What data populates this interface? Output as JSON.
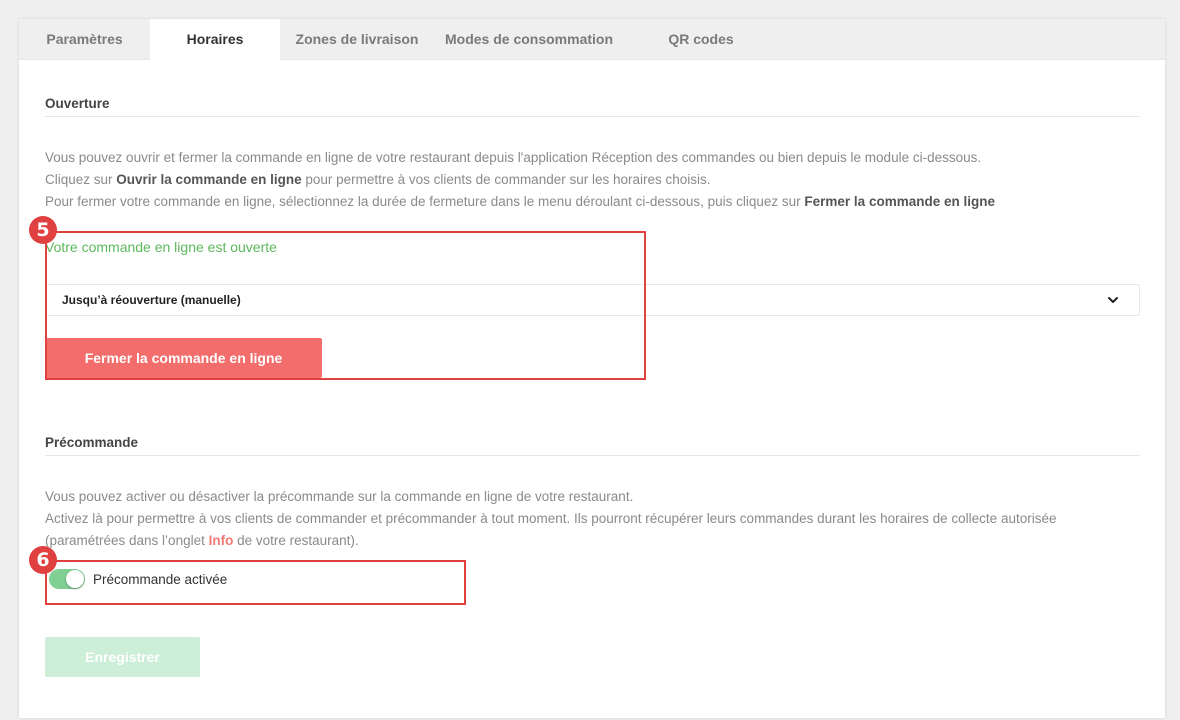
{
  "tabs": [
    {
      "label": "Paramètres"
    },
    {
      "label": "Horaires",
      "active": true
    },
    {
      "label": "Zones de livraison"
    },
    {
      "label": "Modes de consommation"
    },
    {
      "label": "QR codes"
    }
  ],
  "opening": {
    "title": "Ouverture",
    "line1": "Vous pouvez ouvrir et fermer la commande en ligne de votre restaurant depuis l'application Réception des commandes ou bien depuis le module ci-dessous.",
    "line2_prefix": "Cliquez sur ",
    "line2_bold": "Ouvrir la commande en ligne",
    "line2_suffix": " pour permettre à vos clients de commander sur les horaires choisis.",
    "line3_prefix": "Pour fermer votre commande en ligne, sélectionnez la durée de fermeture dans le menu déroulant ci-dessous, puis cliquez sur ",
    "line3_bold": "Fermer la commande en ligne",
    "status": "Votre commande en ligne est ouverte",
    "duration_select_value": "Jusqu’à réouverture (manuelle)",
    "close_button_label": "Fermer la commande en ligne"
  },
  "preorder": {
    "title": "Précommande",
    "line1": "Vous pouvez activer ou désactiver la précommande sur la commande en ligne de votre restaurant.",
    "line2": "Activez là pour permettre à vos clients de commander et précommander à tout moment. Ils pourront récupérer leurs commandes durant les horaires de collecte autorisée",
    "line3_prefix": "(paramétrées dans l’onglet ",
    "line3_link": "Info",
    "line3_suffix": " de votre restaurant).",
    "toggle_label": "Précommande activée",
    "toggle_on": true
  },
  "save_button_label": "Enregistrer",
  "annotations": [
    {
      "number": "5"
    },
    {
      "number": "6"
    }
  ],
  "colors": {
    "accent_red": "#f26d6b",
    "status_green": "#5cb85c",
    "toggle_green": "#7fd092",
    "annotation_red": "#e04040",
    "save_disabled": "#cdeed7"
  }
}
